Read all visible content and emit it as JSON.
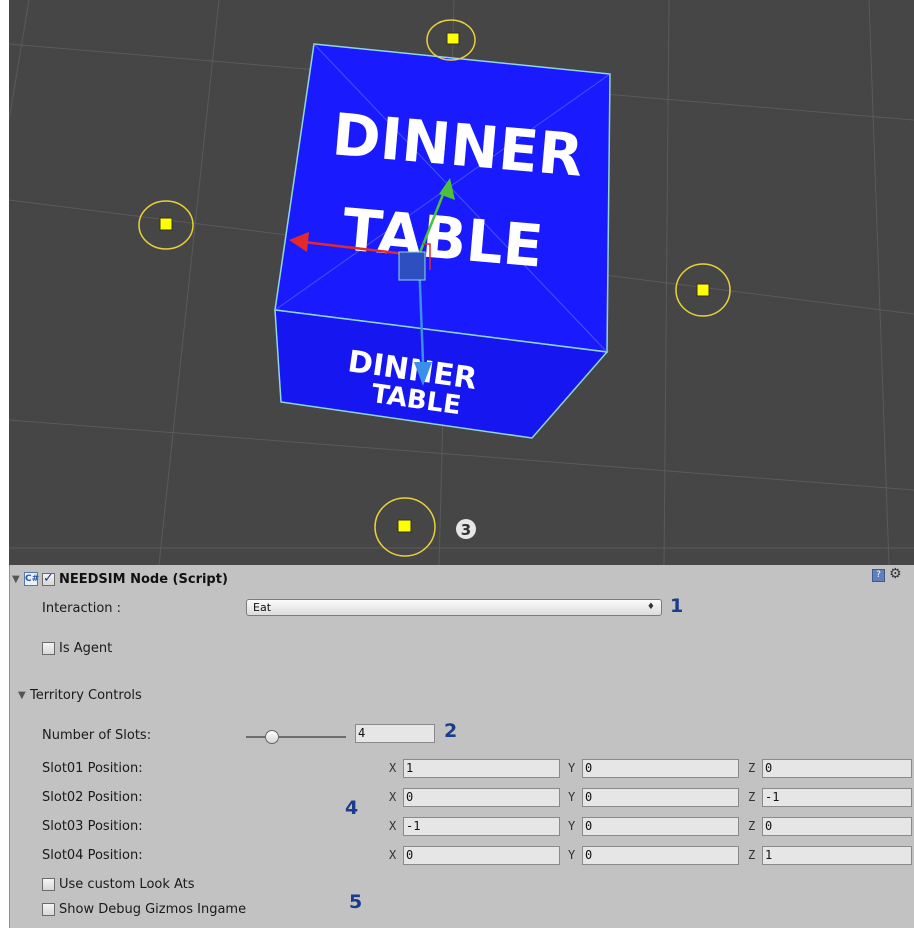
{
  "scene": {
    "front_label_line1": "DINNER",
    "front_label_line2": "TABLE",
    "bottom_label_line1": "DINNER",
    "bottom_label_line2": "TABLE",
    "callout_3": "3"
  },
  "component": {
    "title": "NEEDSIM Node (Script)",
    "script_icon": "script-icon",
    "help_icon": "help-icon",
    "settings_icon": "gear-icon"
  },
  "interaction": {
    "label": "Interaction :",
    "value": "Eat",
    "callout": "1"
  },
  "is_agent": {
    "label": "Is Agent",
    "checked": false
  },
  "territory": {
    "header": "Territory Controls",
    "slots_label": "Number of Slots:",
    "slots_value": "4",
    "callout_2": "2",
    "callout_4": "4",
    "slots": [
      {
        "label": "Slot01 Position:",
        "x": "1",
        "y": "0",
        "z": "0"
      },
      {
        "label": "Slot02 Position:",
        "x": "0",
        "y": "0",
        "z": "-1"
      },
      {
        "label": "Slot03 Position:",
        "x": "-1",
        "y": "0",
        "z": "0"
      },
      {
        "label": "Slot04 Position:",
        "x": "0",
        "y": "0",
        "z": "1"
      }
    ],
    "axis_labels": {
      "x": "X",
      "y": "Y",
      "z": "Z"
    }
  },
  "use_custom_look_ats": {
    "label": "Use custom Look Ats",
    "checked": false
  },
  "show_debug_gizmos": {
    "label": "Show Debug Gizmos Ingame",
    "checked": false,
    "callout": "5"
  },
  "colors": {
    "scene_bg": "#464646",
    "cube_blue": "#1a1aff",
    "gizmo_yellow": "#e8d23a",
    "inspector_bg": "#c2c2c2",
    "callout_blue": "#1a3c8c"
  }
}
